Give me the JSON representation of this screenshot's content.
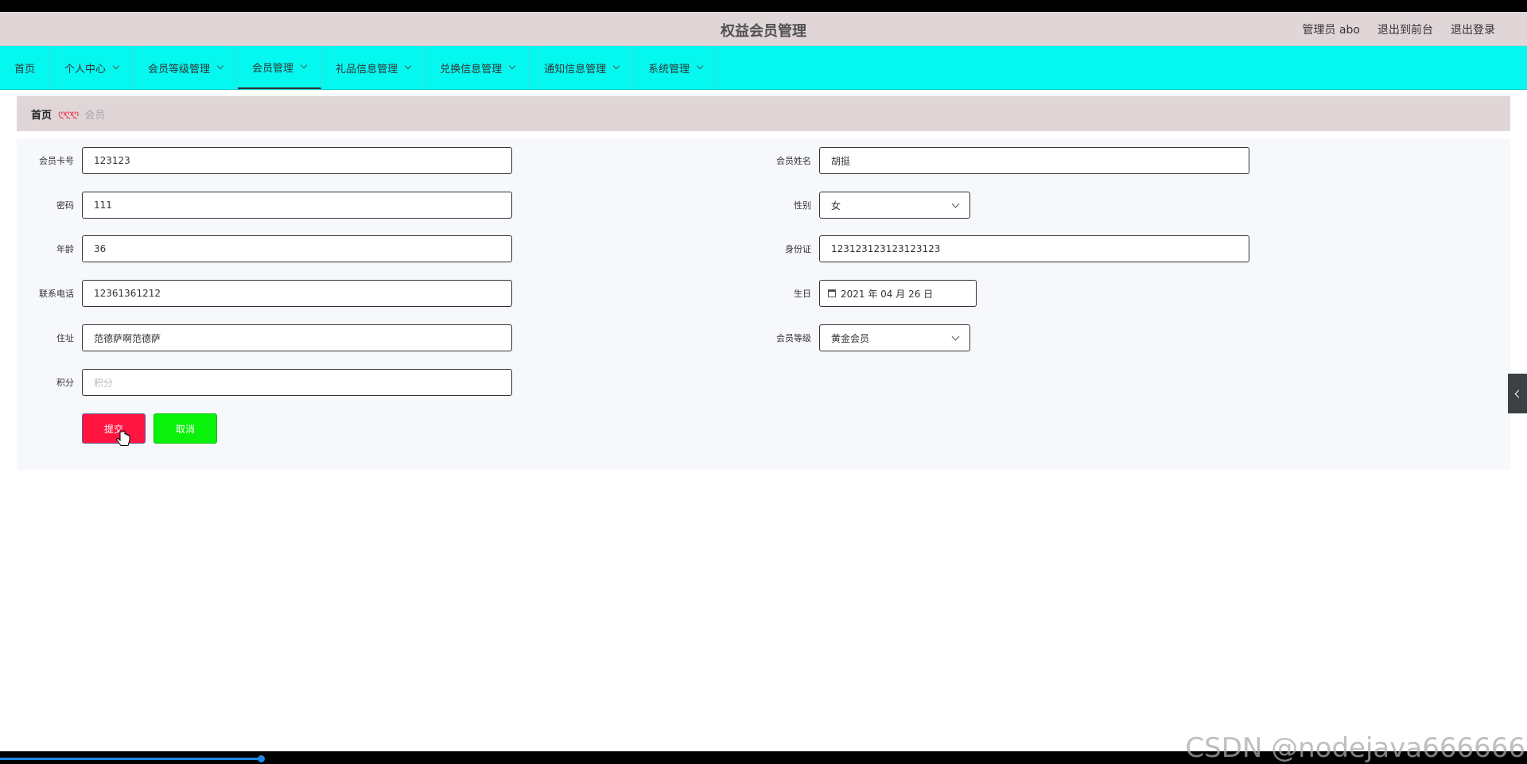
{
  "app": {
    "title": "权益会员管理"
  },
  "header": {
    "admin_label": "管理员 abo",
    "back_front": "退出到前台",
    "logout": "退出登录"
  },
  "nav": {
    "items": [
      {
        "label": "首页"
      },
      {
        "label": "个人中心"
      },
      {
        "label": "会员等级管理"
      },
      {
        "label": "会员管理"
      },
      {
        "label": "礼品信息管理"
      },
      {
        "label": "兑换信息管理"
      },
      {
        "label": "通知信息管理"
      },
      {
        "label": "系统管理"
      }
    ],
    "active_index": 3
  },
  "breadcrumb": {
    "home": "首页",
    "separator": "ღღღ",
    "current": "会员"
  },
  "form": {
    "card_no": {
      "label": "会员卡号",
      "value": "123123"
    },
    "name": {
      "label": "会员姓名",
      "value": "胡挺"
    },
    "password": {
      "label": "密码",
      "value": "111"
    },
    "gender": {
      "label": "性别",
      "value": "女"
    },
    "age": {
      "label": "年龄",
      "value": "36"
    },
    "id_card": {
      "label": "身份证",
      "value": "123123123123123123"
    },
    "phone": {
      "label": "联系电话",
      "value": "12361361212"
    },
    "birthday": {
      "label": "生日",
      "value": "2021 年 04 月 26 日"
    },
    "address": {
      "label": "住址",
      "value": "范德萨啊范德萨"
    },
    "level": {
      "label": "会员等级",
      "value": "黄金会员"
    },
    "points": {
      "label": "积分",
      "placeholder": "积分"
    },
    "submit_label": "提交",
    "cancel_label": "取消"
  },
  "watermark": "CSDN @nodejava666666",
  "colors": {
    "header_bg": "#e0d6d8",
    "nav_bg": "#05f8f0",
    "submit_bg": "#ff1540",
    "cancel_bg": "#0af20a"
  }
}
